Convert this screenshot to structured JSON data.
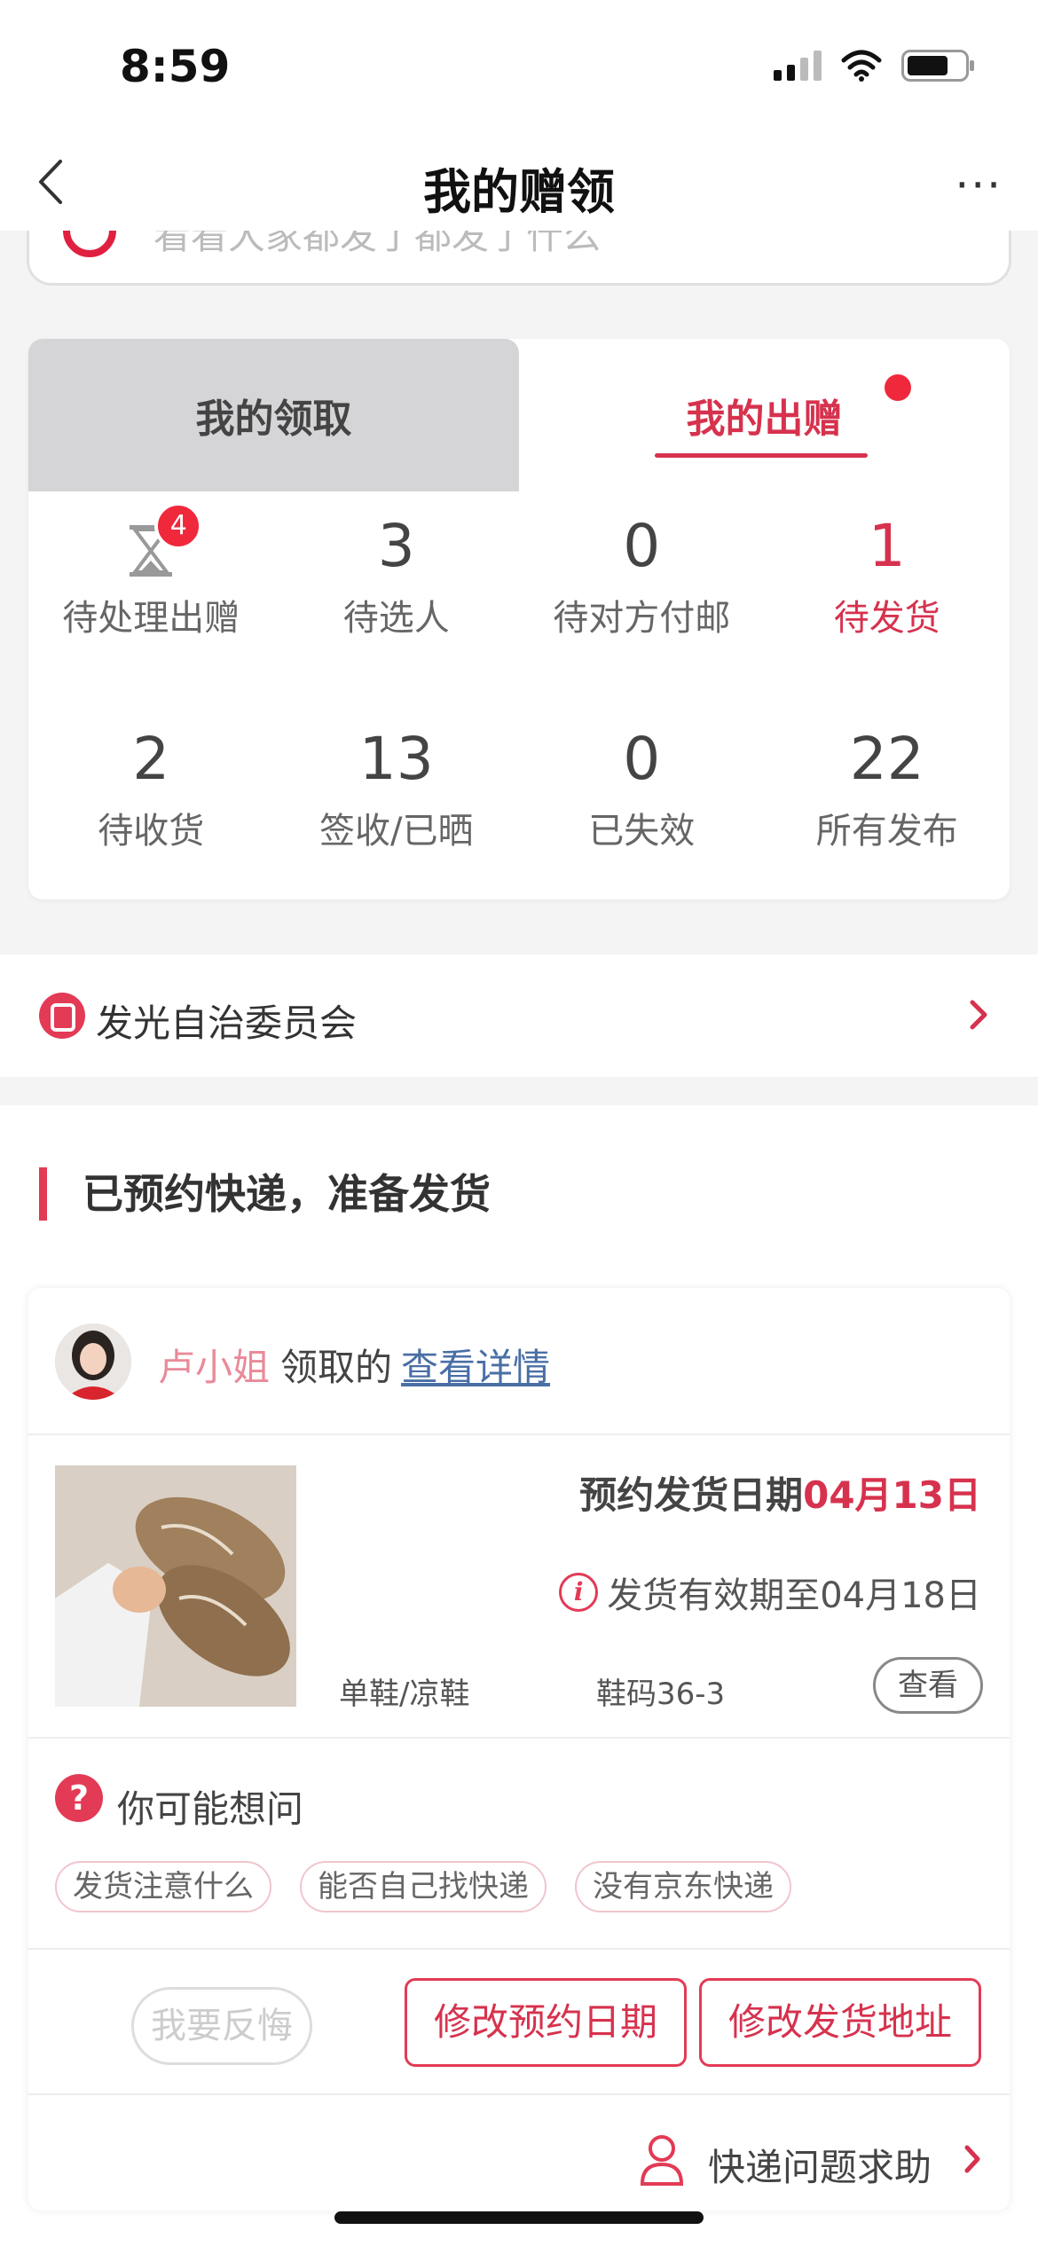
{
  "status": {
    "time": "8:59"
  },
  "nav": {
    "title": "我的赠领",
    "more": "···"
  },
  "search": {
    "placeholder": "看看大家都发了都发了什么"
  },
  "tabs": {
    "receive": "我的领取",
    "give": "我的出赠"
  },
  "stats": [
    {
      "value": "",
      "label": "待处理出赠",
      "badge": "4",
      "icon": "hourglass-icon"
    },
    {
      "value": "3",
      "label": "待选人"
    },
    {
      "value": "0",
      "label": "待对方付邮"
    },
    {
      "value": "1",
      "label": "待发货",
      "highlight": true
    },
    {
      "value": "2",
      "label": "待收货"
    },
    {
      "value": "13",
      "label": "签收/已晒"
    },
    {
      "value": "0",
      "label": "已失效"
    },
    {
      "value": "22",
      "label": "所有发布"
    }
  ],
  "committee": {
    "label": "发光自治委员会"
  },
  "section": {
    "title": "已预约快递，准备发货"
  },
  "order": {
    "user_name": "卢小姐",
    "action": "领取的",
    "detail_link": "查看详情",
    "ship_date_label": "预约发货日期",
    "ship_date_value": "04月13日",
    "valid_until": "发货有效期至04月18日",
    "category": "单鞋/凉鞋",
    "size": "鞋码36-3",
    "view": "查看"
  },
  "faq": {
    "title": "你可能想问",
    "chips": [
      "发货注意什么",
      "能否自己找快递",
      "没有京东快递"
    ]
  },
  "actions": {
    "regret": "我要反悔",
    "change_date": "修改预约日期",
    "change_address": "修改发货地址"
  },
  "help": {
    "label": "快递问题求助"
  },
  "colors": {
    "accent": "#d6324e",
    "badge": "#f0283c",
    "link": "#4a6fa5"
  }
}
